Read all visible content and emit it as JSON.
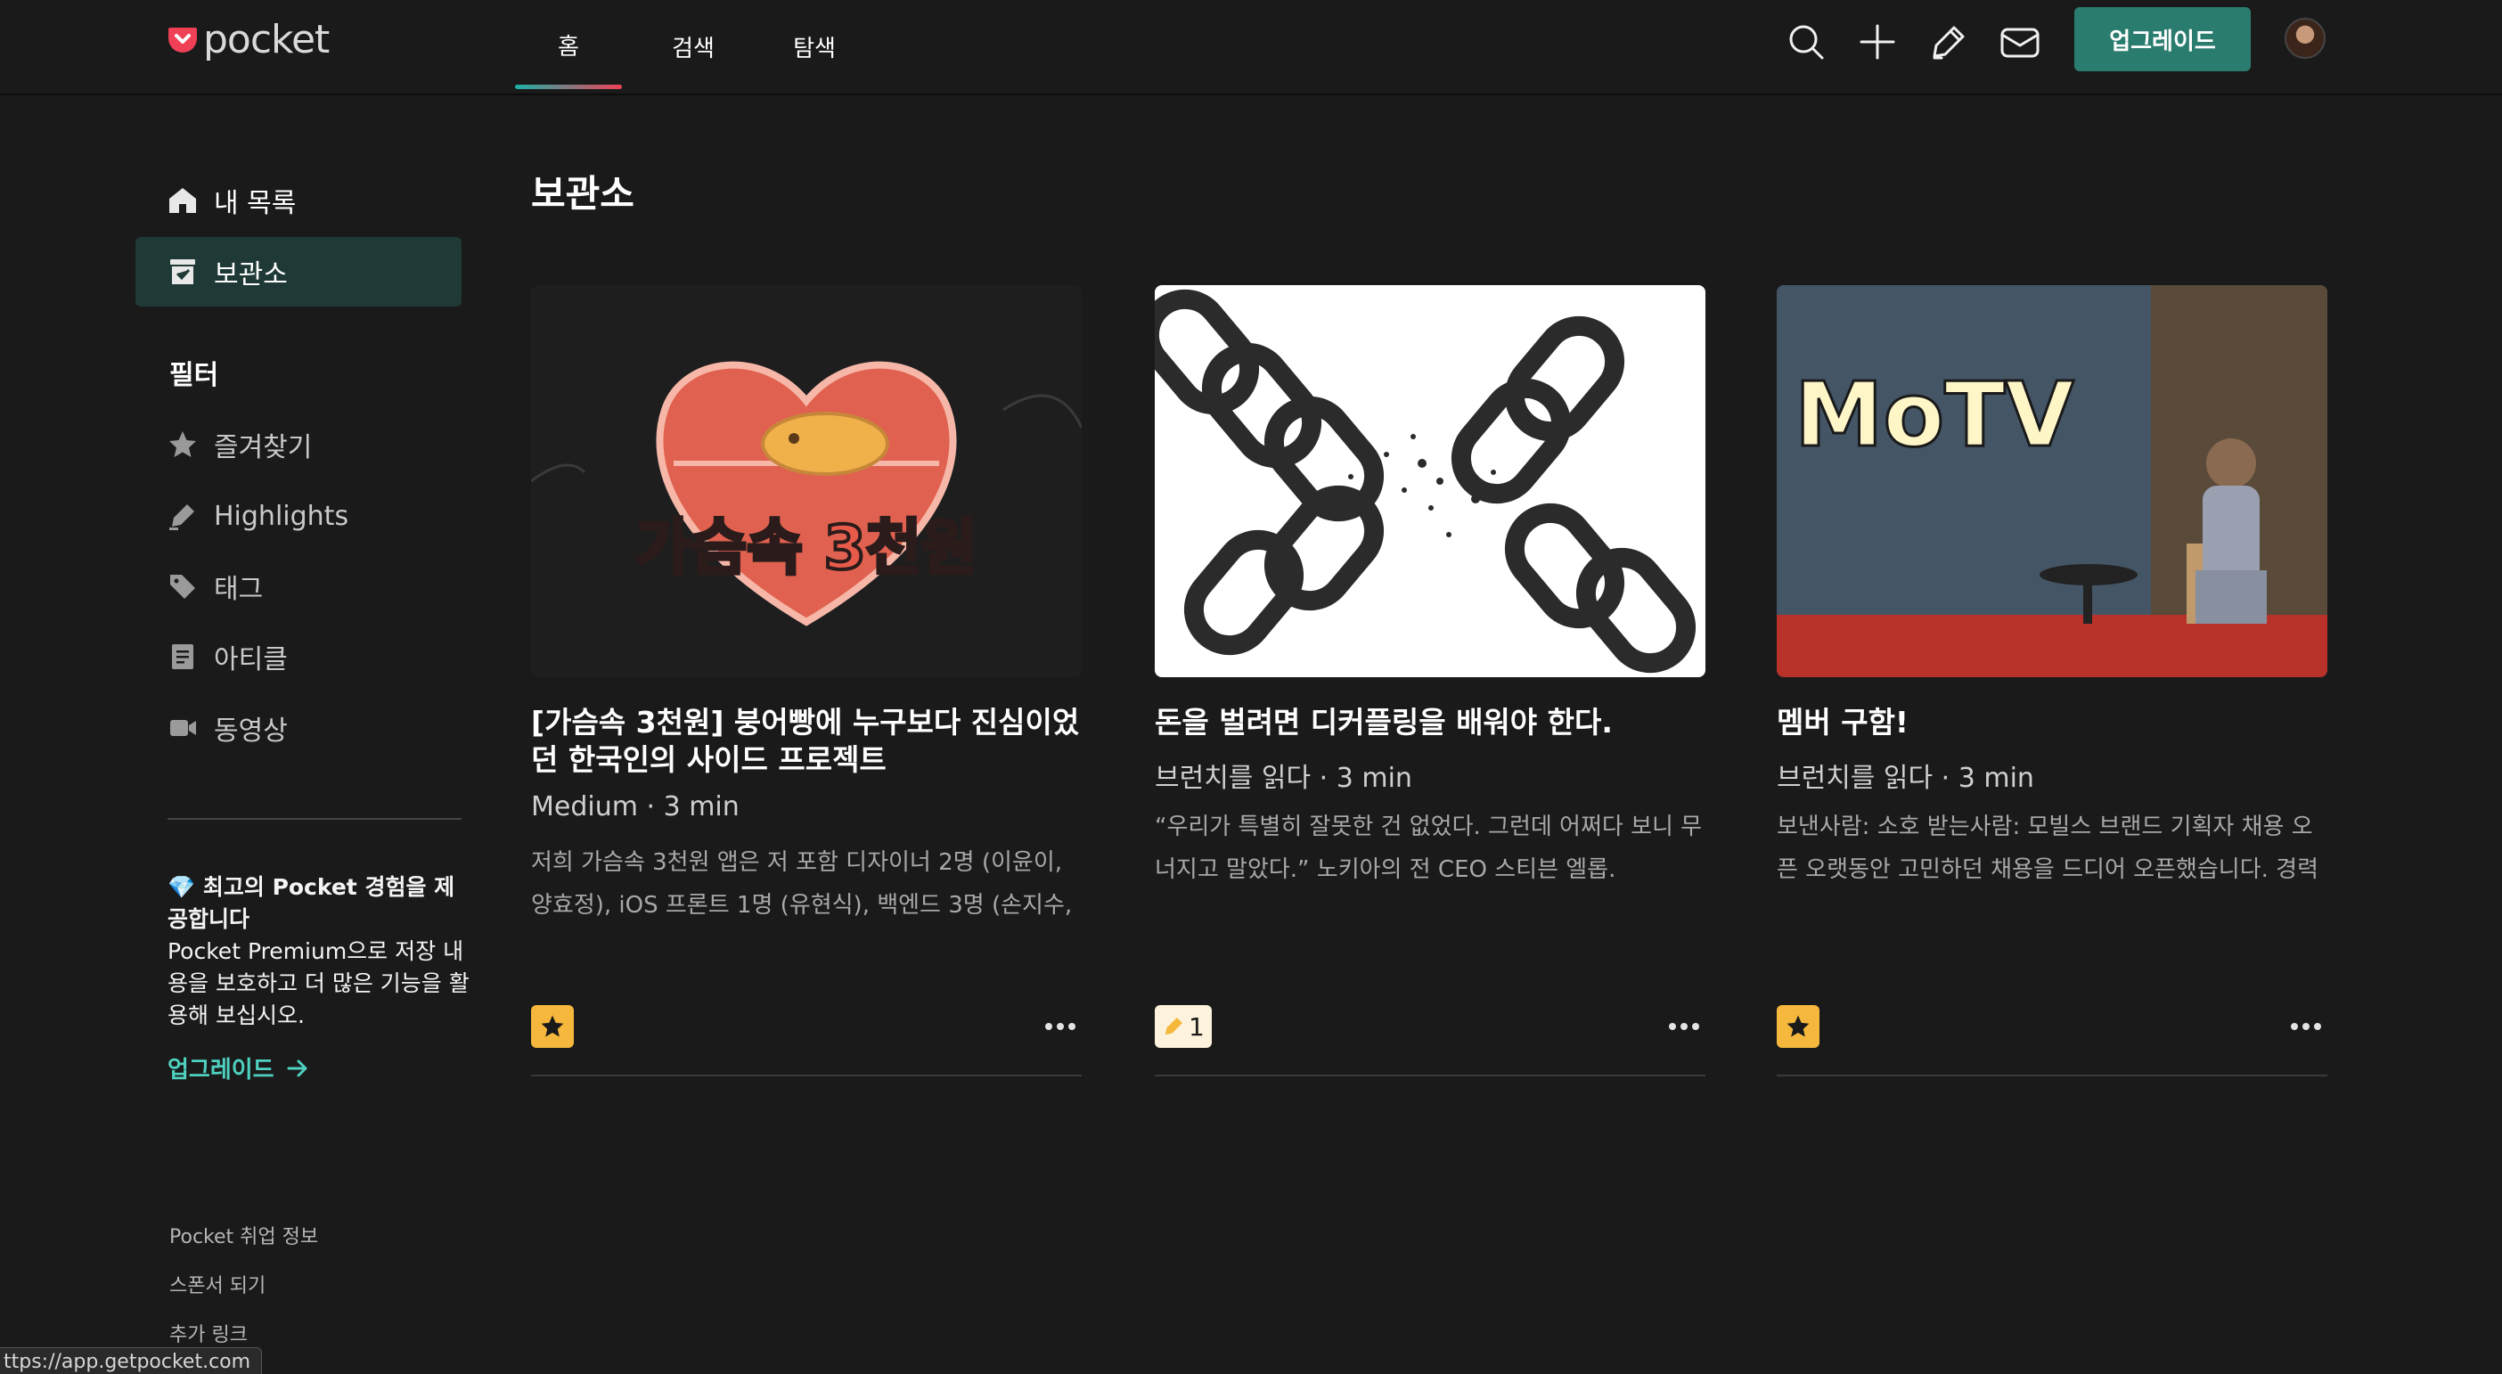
{
  "brand": {
    "name": "pocket",
    "accent": "#ef4056",
    "teal": "#2a7c6f"
  },
  "nav": {
    "tabs": [
      {
        "label": "홈",
        "active": true
      },
      {
        "label": "검색",
        "active": false
      },
      {
        "label": "탐색",
        "active": false
      }
    ],
    "tools": [
      "search-icon",
      "add-icon",
      "highlighter-icon",
      "inbox-icon"
    ],
    "upgrade_label": "업그레이드"
  },
  "sidebar": {
    "items": [
      {
        "label": "내 목록",
        "icon": "home-icon",
        "active": false
      },
      {
        "label": "보관소",
        "icon": "archive-icon",
        "active": true
      }
    ],
    "filter_heading": "필터",
    "filters": [
      {
        "label": "즐겨찾기",
        "icon": "star-icon"
      },
      {
        "label": "Highlights",
        "icon": "highlighter-icon"
      },
      {
        "label": "태그",
        "icon": "tag-icon"
      },
      {
        "label": "아티클",
        "icon": "article-icon"
      },
      {
        "label": "동영상",
        "icon": "video-icon"
      }
    ],
    "promo": {
      "emoji": "💎",
      "title": "최고의 Pocket 경험을 제공합니다",
      "body": "Pocket Premium으로 저장 내용을 보호하고 더 많은 기능을 활용해 보십시오.",
      "link": "업그레이드"
    },
    "footer_links": [
      "Pocket 취업 정보",
      "스폰서 되기",
      "추가 링크"
    ]
  },
  "status_url": "ttps://app.getpocket.com",
  "main": {
    "title": "보관소",
    "cards": [
      {
        "title": "[가슴속 3천원] 붕어빵에 누구보다 진심이었던 한국인의 사이드 프로젝트",
        "meta": "Medium · 3 min",
        "excerpt": "저희 가슴속 3천원 앱은 저 포함 디자이너 2명 (이윤이, 양효정), iOS 프론트 1명 (유현식), 백엔드 3명 (손지수,",
        "thumb_text": "가슴속 3천원",
        "badge": {
          "type": "favorite",
          "icon": "star-icon"
        }
      },
      {
        "title": "돈을 벌려면 디커플링을 배워야 한다.",
        "meta": "브런치를 읽다 · 3 min",
        "excerpt": "“우리가 특별히 잘못한 건 없었다. 그런데 어쩌다 보니 무너지고 말았다.” 노키아의 전 CEO 스티븐 엘롭.",
        "badge": {
          "type": "highlights",
          "icon": "highlighter-icon",
          "count": "1"
        }
      },
      {
        "title": "멤버 구함!",
        "meta": "브런치를 읽다 · 3 min",
        "excerpt": "보낸사람: 소호 받는사람: 모빌스 브랜드 기획자 채용 오픈 오랫동안 고민하던 채용을 드디어 오픈했습니다. 경력",
        "thumb_text": "MoTV",
        "badge": {
          "type": "favorite",
          "icon": "star-icon"
        }
      }
    ]
  }
}
